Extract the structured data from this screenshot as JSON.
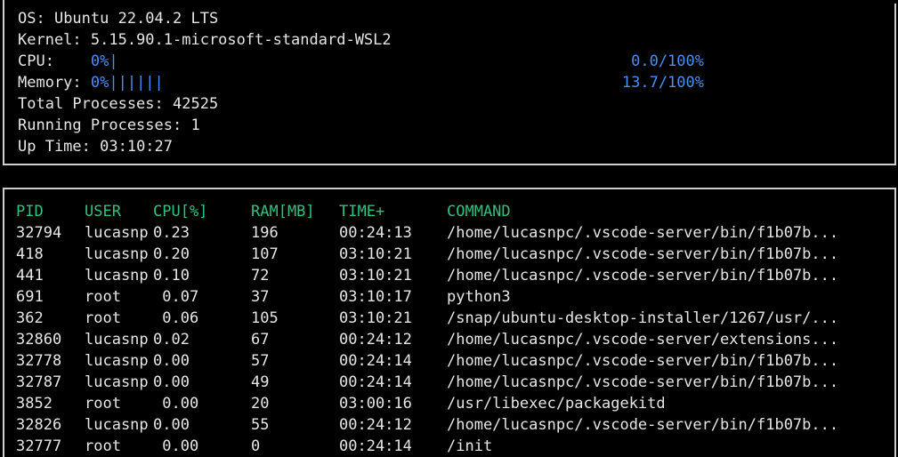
{
  "sysinfo": {
    "os_label": "OS: ",
    "os_value": "Ubuntu 22.04.2 LTS",
    "kernel_label": "Kernel: ",
    "kernel_value": "5.15.90.1-microsoft-standard-WSL2",
    "cpu_label": "CPU:    ",
    "cpu_bar": "0%|",
    "cpu_percent": "0.0/100%",
    "cpu_level_percent": 0.0,
    "memory_label": "Memory: ",
    "memory_bar": "0%||||||",
    "memory_percent": "13.7/100%",
    "memory_level_percent": 13.7,
    "total_processes_label": "Total Processes: ",
    "total_processes_value": "42525",
    "running_processes_label": "Running Processes: ",
    "running_processes_value": "1",
    "uptime_label": "Up Time: ",
    "uptime_value": "03:10:27"
  },
  "process_table": {
    "headers": {
      "pid": "PID",
      "user": "USER",
      "cpu": "CPU[%]",
      "ram": "RAM[MB]",
      "time": "TIME+",
      "command": "COMMAND"
    },
    "rows": [
      {
        "pid": "32794",
        "user": "lucasnp",
        "cpu": "0.23",
        "ram": "196",
        "time": "00:24:13",
        "command": "/home/lucasnpc/.vscode-server/bin/f1b07b..."
      },
      {
        "pid": "418",
        "user": "lucasnp",
        "cpu": "0.20",
        "ram": "107",
        "time": "03:10:21",
        "command": "/home/lucasnpc/.vscode-server/bin/f1b07b..."
      },
      {
        "pid": "441",
        "user": "lucasnp",
        "cpu": "0.10",
        "ram": "72",
        "time": "03:10:21",
        "command": "/home/lucasnpc/.vscode-server/bin/f1b07b..."
      },
      {
        "pid": "691",
        "user": "root",
        "cpu": " 0.07",
        "ram": "37",
        "time": "03:10:17",
        "command": "python3"
      },
      {
        "pid": "362",
        "user": "root",
        "cpu": " 0.06",
        "ram": "105",
        "time": "03:10:21",
        "command": "/snap/ubuntu-desktop-installer/1267/usr/..."
      },
      {
        "pid": "32860",
        "user": "lucasnp",
        "cpu": "0.02",
        "ram": "67",
        "time": "00:24:12",
        "command": "/home/lucasnpc/.vscode-server/extensions..."
      },
      {
        "pid": "32778",
        "user": "lucasnp",
        "cpu": "0.00",
        "ram": "57",
        "time": "00:24:14",
        "command": "/home/lucasnpc/.vscode-server/bin/f1b07b..."
      },
      {
        "pid": "32787",
        "user": "lucasnp",
        "cpu": "0.00",
        "ram": "49",
        "time": "00:24:14",
        "command": "/home/lucasnpc/.vscode-server/bin/f1b07b..."
      },
      {
        "pid": "3852",
        "user": "root",
        "cpu": " 0.00",
        "ram": "20",
        "time": "03:00:16",
        "command": "/usr/libexec/packagekitd"
      },
      {
        "pid": "32826",
        "user": "lucasnp",
        "cpu": "0.00",
        "ram": "55",
        "time": "00:24:12",
        "command": "/home/lucasnpc/.vscode-server/bin/f1b07b..."
      },
      {
        "pid": "32777",
        "user": "root",
        "cpu": " 0.00",
        "ram": "0",
        "time": "00:24:14",
        "command": "/init"
      }
    ]
  },
  "colors": {
    "background": "#000000",
    "text": "#e6e6e6",
    "accent_blue": "#4a8ff0",
    "header_green": "#2ec27e",
    "border": "#cfcfcf"
  }
}
